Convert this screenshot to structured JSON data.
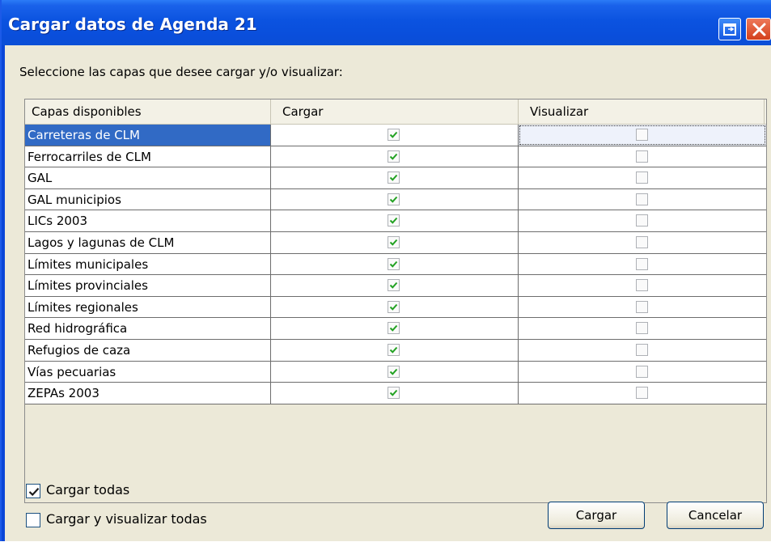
{
  "window": {
    "title": "Cargar datos de Agenda 21",
    "restore_icon": "restore-icon",
    "close_icon": "close-icon",
    "title_bar_color": "#0a4edb",
    "close_button_color": "#d4401c"
  },
  "prompt": "Seleccione las capas que desee cargar y/o visualizar:",
  "table": {
    "columns": [
      "Capas disponibles",
      "Cargar",
      "Visualizar"
    ],
    "rows": [
      {
        "name": "Carreteras de CLM",
        "cargar": true,
        "visualizar": false,
        "selected": true
      },
      {
        "name": "Ferrocarriles de CLM",
        "cargar": true,
        "visualizar": false
      },
      {
        "name": "GAL",
        "cargar": true,
        "visualizar": false
      },
      {
        "name": "GAL municipios",
        "cargar": true,
        "visualizar": false
      },
      {
        "name": "LICs 2003",
        "cargar": true,
        "visualizar": false
      },
      {
        "name": "Lagos y lagunas de CLM",
        "cargar": true,
        "visualizar": false
      },
      {
        "name": "Límites municipales",
        "cargar": true,
        "visualizar": false
      },
      {
        "name": "Límites provinciales",
        "cargar": true,
        "visualizar": false
      },
      {
        "name": "Límites regionales",
        "cargar": true,
        "visualizar": false
      },
      {
        "name": "Red hidrográfica",
        "cargar": true,
        "visualizar": false
      },
      {
        "name": "Refugios de caza",
        "cargar": true,
        "visualizar": false
      },
      {
        "name": "Vías pecuarias",
        "cargar": true,
        "visualizar": false
      },
      {
        "name": "ZEPAs 2003",
        "cargar": true,
        "visualizar": false
      }
    ],
    "selection_color": "#316ac5",
    "check_color": "#21a121"
  },
  "options": {
    "cargar_todas": {
      "label": "Cargar todas",
      "checked": true
    },
    "cargar_visualizar_todas": {
      "label": "Cargar y visualizar todas",
      "checked": false
    }
  },
  "buttons": {
    "cargar": "Cargar",
    "cancelar": "Cancelar"
  }
}
